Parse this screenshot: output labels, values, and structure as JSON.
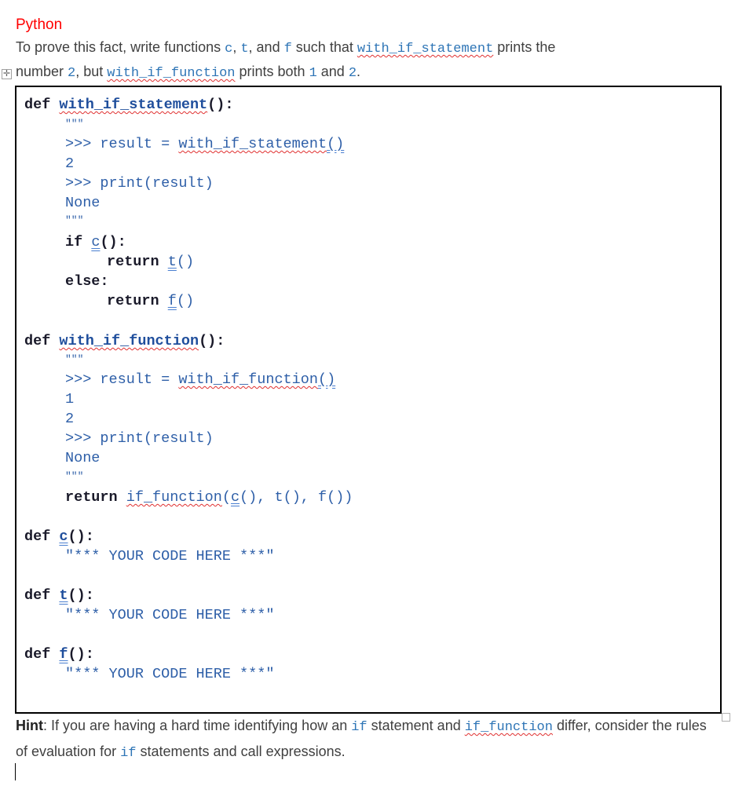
{
  "heading": "Python",
  "intro": {
    "line1_a": "To prove this fact, write functions ",
    "c": "c",
    "sep1": ", ",
    "t": "t",
    "sep2": ", and ",
    "f": "f",
    "line1_b": " such that ",
    "with_if_statement": "with_if_statement",
    "line1_c": " prints the",
    "line2_a": "number ",
    "two": "2",
    "line2_b": ", but ",
    "with_if_function": "with_if_function",
    "line2_c": " prints both ",
    "one": "1",
    "line2_d": " and ",
    "two_b": "2",
    "line2_e": "."
  },
  "code": {
    "def_kw": "def",
    "return_kw": "return",
    "if_kw": "if",
    "else_kw": "else:",
    "triple_quote": "\"\"\"",
    "block1": {
      "name": "with_if_statement",
      "parens": "():",
      "doc_call": ">>> result = ",
      "doc_call_fn": "with_if_statement",
      "doc_call_parens": "()",
      "doc_out": "2",
      "doc_print": ">>> print(result)",
      "doc_none": "None",
      "if_c": "c",
      "if_tail": "():",
      "ret_t": "t",
      "ret_f": "f",
      "call_parens": "()"
    },
    "block2": {
      "name": "with_if_function",
      "parens": "():",
      "doc_call": ">>> result = ",
      "doc_call_fn": "with_if_function",
      "doc_call_parens": "()",
      "doc_out1": "1",
      "doc_out2": "2",
      "doc_print": ">>> print(result)",
      "doc_none": "None",
      "ret_fn": "if_function",
      "ret_open": "(",
      "ret_c": "c",
      "ret_rest": "(), t(), f())"
    },
    "stubs": [
      {
        "name": "c",
        "parens": "():",
        "body": "\"*** YOUR CODE HERE ***\""
      },
      {
        "name": "t",
        "parens": "():",
        "body": "\"*** YOUR CODE HERE ***\""
      },
      {
        "name": "f",
        "parens": "():",
        "body": "\"*** YOUR CODE HERE ***\""
      }
    ]
  },
  "hint": {
    "label": "Hint",
    "a": ": If you are having a hard time identifying how an ",
    "if1": "if",
    "b": " statement and ",
    "if_function": "if_function",
    "c": " differ, consider the rules of evaluation for ",
    "if2": "if",
    "d": " statements and call expressions."
  },
  "icons": {
    "table_move": "table-move-handle-icon",
    "table_resize": "table-resize-handle-icon"
  }
}
